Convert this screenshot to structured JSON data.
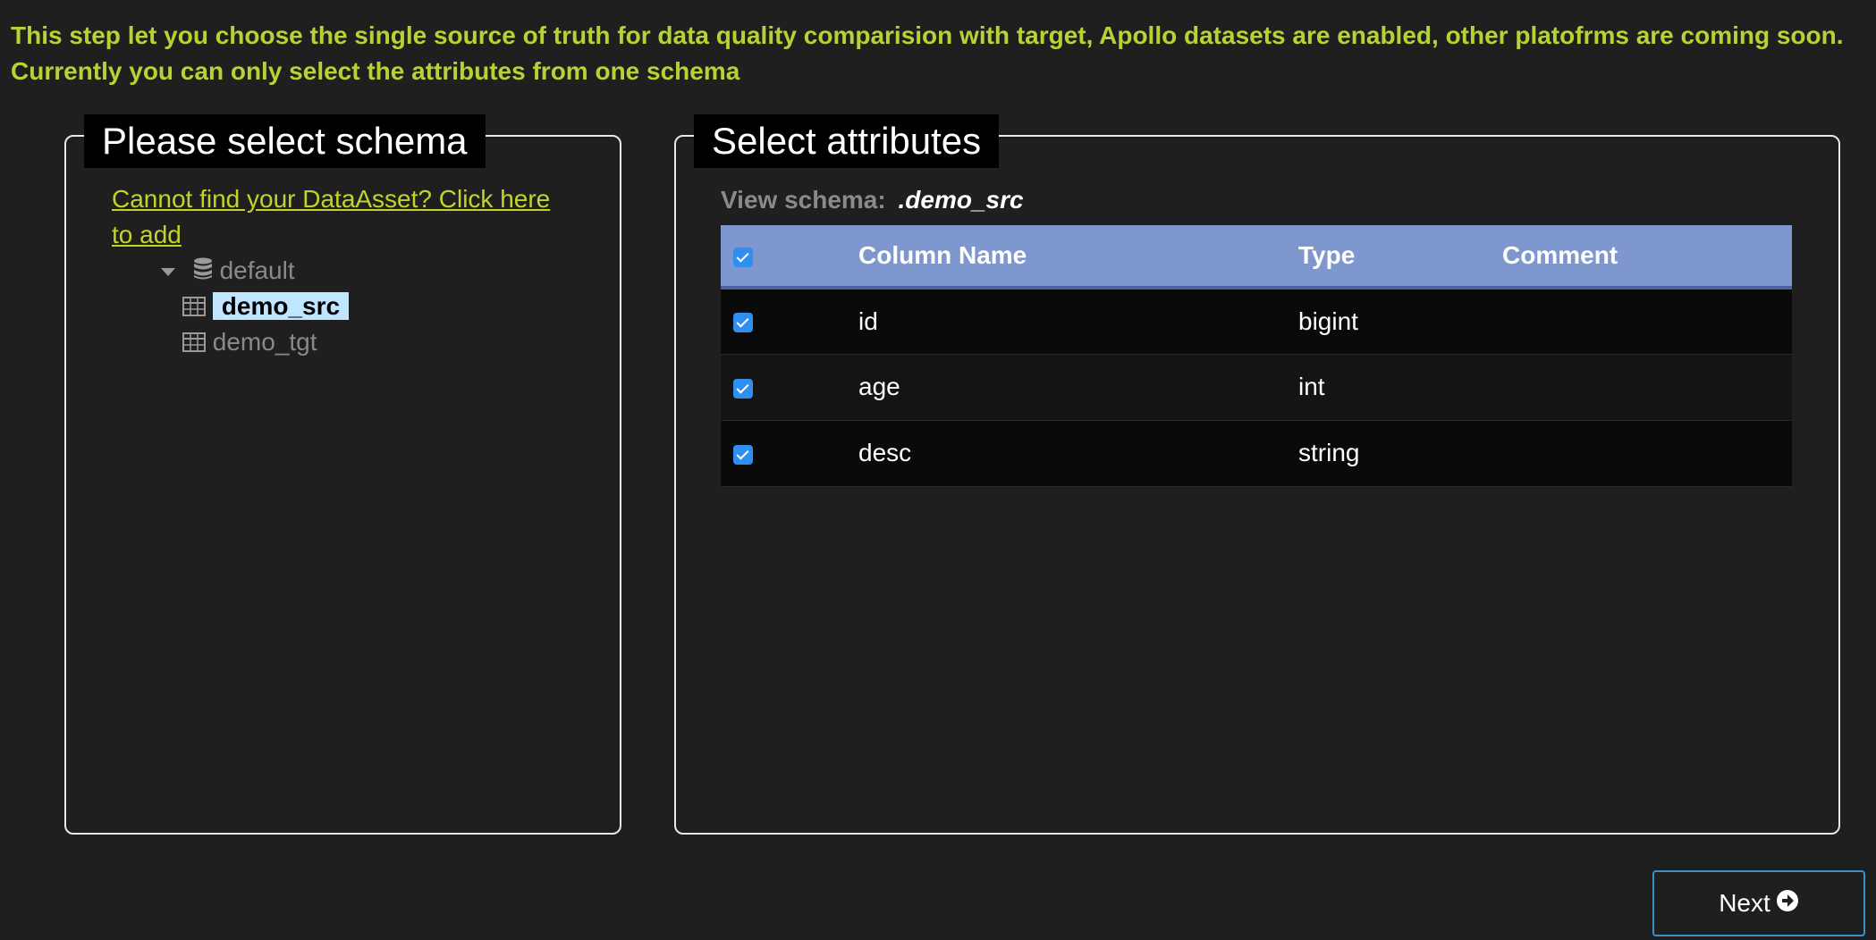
{
  "info": {
    "line1": "This step let you choose the single source of truth for data quality comparision with target, Apollo datasets are enabled, other platofrms are coming soon.",
    "line2": "Currently you can only select the attributes from one schema"
  },
  "schema_panel": {
    "legend": "Please select schema",
    "add_link": "Cannot find your DataAsset? Click here to add",
    "tree": {
      "database": {
        "label": "default",
        "icon": "database-icon",
        "expanded": true
      },
      "tables": [
        {
          "label": "demo_src",
          "icon": "table-icon",
          "selected": true
        },
        {
          "label": "demo_tgt",
          "icon": "table-icon",
          "selected": false
        }
      ]
    }
  },
  "attributes_panel": {
    "legend": "Select attributes",
    "view_schema_label": "View schema:",
    "view_schema_name": ".demo_src",
    "columns": [
      "Column Name",
      "Type",
      "Comment"
    ],
    "header_checked": true,
    "rows": [
      {
        "checked": true,
        "name": "id",
        "type": "bigint",
        "comment": ""
      },
      {
        "checked": true,
        "name": "age",
        "type": "int",
        "comment": ""
      },
      {
        "checked": true,
        "name": "desc",
        "type": "string",
        "comment": ""
      }
    ]
  },
  "footer": {
    "next_label": "Next",
    "next_icon": "arrow-circle-right-icon"
  },
  "colors": {
    "background": "#1f1f1f",
    "info_text": "#b5d334",
    "link": "#c4d32c",
    "table_header": "#7e97ce",
    "selected_node": "#bfe5ff",
    "checkbox": "#2f8ff0",
    "button_border": "#3c8fc7"
  }
}
